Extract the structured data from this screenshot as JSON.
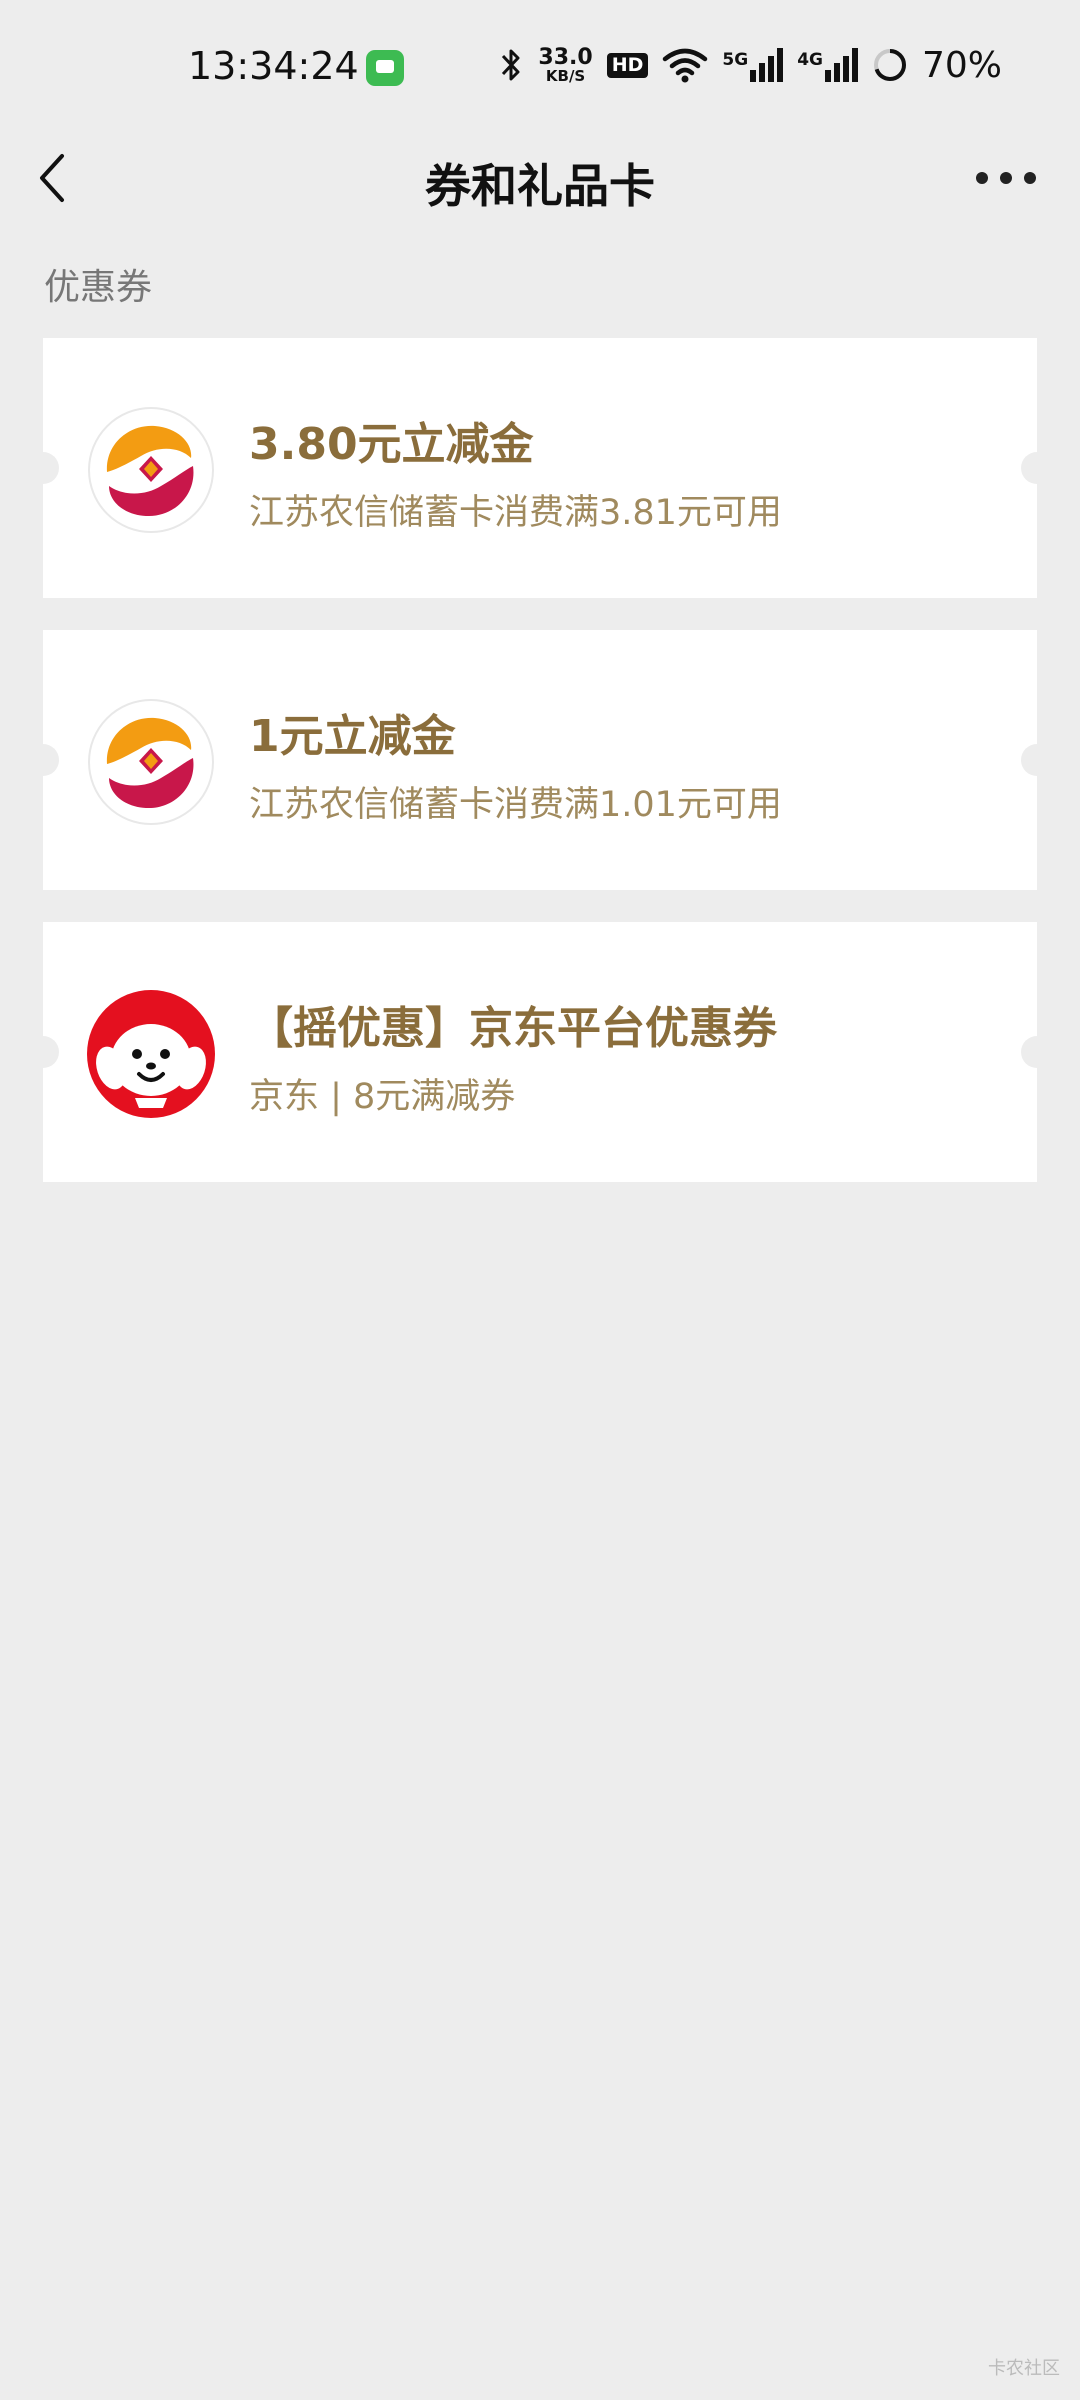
{
  "status_bar": {
    "time": "13:34:24",
    "speed_value": "33.0",
    "speed_unit": "KB/S",
    "hd_label": "HD",
    "net1_label": "5G",
    "net2_label": "4G",
    "battery": "70%",
    "battery_level": 0.7
  },
  "header": {
    "title": "券和礼品卡"
  },
  "section": {
    "label": "优惠券"
  },
  "coupons": [
    {
      "title": "3.80元立减金",
      "desc": "江苏农信储蓄卡消费满3.81元可用",
      "logo": "bank-logo-icon"
    },
    {
      "title": "1元立减金",
      "desc": "江苏农信储蓄卡消费满1.01元可用",
      "logo": "bank-logo-icon"
    },
    {
      "title": "【摇优惠】京东平台优惠券",
      "desc": "京东 | 8元满减券",
      "logo": "jd-mascot-icon"
    }
  ],
  "watermark": "卡农社区",
  "colors": {
    "background": "#ededed",
    "coupon_title": "#8a6d3b",
    "coupon_desc": "#a08a5e",
    "bank_orange": "#f39c12",
    "bank_red": "#c8174a",
    "jd_red": "#e4101f"
  }
}
